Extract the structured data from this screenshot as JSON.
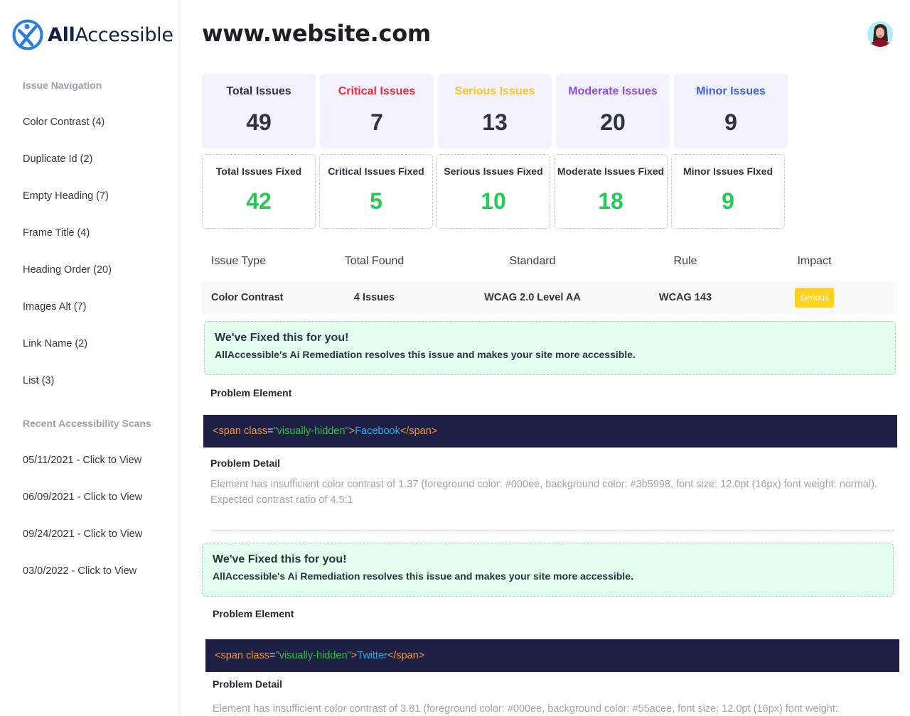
{
  "brand": {
    "logo_bold": "All",
    "logo_rest": "Accessible",
    "accent": "#1f6fe0"
  },
  "header": {
    "site": "www.website.com",
    "avatar_alt": "user avatar"
  },
  "sidebar": {
    "issue_nav_heading": "Issue Navigation",
    "issue_items": [
      "Color Contrast (4)",
      "Duplicate Id (2)",
      "Empty Heading (7)",
      "Frame Title (4)",
      "Heading Order (20)",
      "Images Alt (7)",
      "Link Name (2)",
      "List (3)"
    ],
    "scans_heading": "Recent Accessibility Scans",
    "scans": [
      "05/11/2021 - Click to View",
      "06/09/2021 - Click to View",
      "09/24/2021 - Click to View",
      "03/0/2022 - Click to View"
    ]
  },
  "stats": [
    {
      "label": "Total Issues",
      "value": "49",
      "color": "#2d3340"
    },
    {
      "label": "Critical Issues",
      "value": "7",
      "color": "#ee2a37"
    },
    {
      "label": "Serious Issues",
      "value": "13",
      "color": "#fcc71c"
    },
    {
      "label": "Moderate Issues",
      "value": "20",
      "color": "#8c4fe0"
    },
    {
      "label": "Minor Issues",
      "value": "9",
      "color": "#3a62e6"
    }
  ],
  "fixed_stats": [
    {
      "label": "Total Issues Fixed",
      "value": "42"
    },
    {
      "label": "Critical Issues Fixed",
      "value": "5"
    },
    {
      "label": "Serious Issues Fixed",
      "value": "10"
    },
    {
      "label": "Moderate Issues Fixed",
      "value": "18"
    },
    {
      "label": "Minor Issues FIxed",
      "value": "9"
    }
  ],
  "fixed_color": "#22cc55",
  "table": {
    "headers": [
      "Issue Type",
      "Total Found",
      "Standard",
      "Rule",
      "Impact"
    ],
    "row": {
      "issue_type": "Color Contrast",
      "total_found": "4 Issues",
      "standard": "WCAG 2.0 Level AA",
      "rule": "WCAG 143",
      "impact": "Serious"
    }
  },
  "findings": [
    {
      "fix_title": "We've Fixed this for you!",
      "fix_desc": "AllAccessible's Ai Remediation resolves this issue and makes your site more accessible.",
      "problem_element_label": "Problem Element",
      "code": {
        "open": "<span ",
        "attr": "class",
        "eq": "=",
        "str": "\"visually-hidden\"",
        "gt": ">",
        "text": "Facebook",
        "close": "</span>"
      },
      "problem_detail_label": "Problem Detail",
      "detail": "Element has insufficient color contrast of 1.37 (foreground color: #000ee, background color: #3b5998, font size: 12.0pt (16px) font weight: normal). Expected contrast ratio of 4.5:1"
    },
    {
      "fix_title": "We've Fixed this for you!",
      "fix_desc": "AllAccessible's Ai Remediation resolves this issue and makes your site more accessible.",
      "problem_element_label": "Problem Element",
      "code": {
        "open": "<span ",
        "attr": "class",
        "eq": "=",
        "str": "\"visually-hidden\"",
        "gt": ">",
        "text": "Twitter",
        "close": "</span>"
      },
      "problem_detail_label": "Problem Detail",
      "detail": "Element has insufficient color contrast of 3.81 (foreground color: #000ee, background color: #55acee, font size: 12.0pt (16px) font weight:"
    }
  ]
}
